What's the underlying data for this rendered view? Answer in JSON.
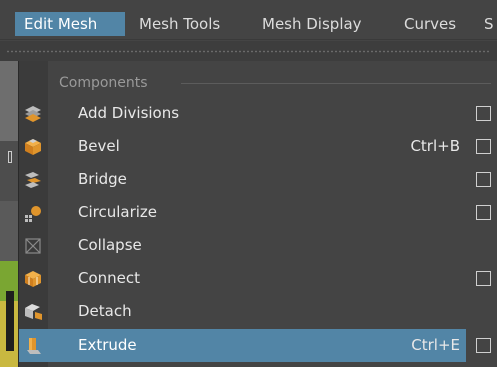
{
  "menubar": {
    "items": [
      {
        "label": "Edit Mesh",
        "active": true
      },
      {
        "label": "Mesh Tools",
        "active": false
      },
      {
        "label": "Mesh Display",
        "active": false
      },
      {
        "label": "Curves",
        "active": false
      },
      {
        "label": "S",
        "active": false
      }
    ]
  },
  "menu": {
    "section_label": "Components",
    "items": [
      {
        "label": "Add Divisions",
        "shortcut": "",
        "icon": "add-divisions-icon",
        "option_box": true,
        "highlighted": false
      },
      {
        "label": "Bevel",
        "shortcut": "Ctrl+B",
        "icon": "bevel-icon",
        "option_box": true,
        "highlighted": false
      },
      {
        "label": "Bridge",
        "shortcut": "",
        "icon": "bridge-icon",
        "option_box": true,
        "highlighted": false
      },
      {
        "label": "Circularize",
        "shortcut": "",
        "icon": "circularize-icon",
        "option_box": true,
        "highlighted": false
      },
      {
        "label": "Collapse",
        "shortcut": "",
        "icon": "collapse-icon",
        "option_box": false,
        "highlighted": false
      },
      {
        "label": "Connect",
        "shortcut": "",
        "icon": "connect-icon",
        "option_box": true,
        "highlighted": false
      },
      {
        "label": "Detach",
        "shortcut": "",
        "icon": "detach-icon",
        "option_box": false,
        "highlighted": false
      },
      {
        "label": "Extrude",
        "shortcut": "Ctrl+E",
        "icon": "extrude-icon",
        "option_box": true,
        "highlighted": true
      }
    ]
  },
  "colors": {
    "highlight": "#5285a6",
    "background": "#444444",
    "icon_orange": "#e0952c",
    "icon_gray": "#bdbdbd"
  }
}
